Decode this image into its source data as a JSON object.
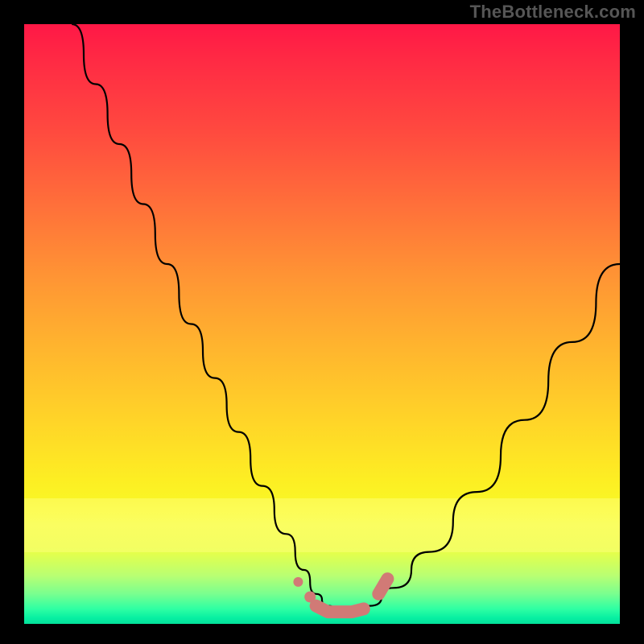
{
  "watermark": "TheBottleneck.com",
  "chart_data": {
    "type": "line",
    "title": "",
    "xlabel": "",
    "ylabel": "",
    "xlim": [
      0,
      100
    ],
    "ylim": [
      0,
      100
    ],
    "grid": false,
    "legend": false,
    "series": [
      {
        "name": "bottleneck-curve",
        "color": "#000000",
        "x": [
          8,
          12,
          16,
          20,
          24,
          28,
          32,
          36,
          40,
          44,
          47,
          49,
          51,
          53,
          56,
          58,
          62,
          68,
          76,
          84,
          92,
          100
        ],
        "values": [
          100,
          90,
          80,
          70,
          60,
          50,
          41,
          32,
          23,
          15,
          9,
          5,
          3,
          2,
          2,
          3,
          6,
          12,
          22,
          34,
          47,
          60
        ]
      }
    ],
    "markers": [
      {
        "name": "flat-range-dots",
        "color": "#d17a76",
        "points": [
          {
            "x": 46,
            "y": 7
          },
          {
            "x": 48,
            "y": 4.5
          },
          {
            "x": 49,
            "y": 3
          },
          {
            "x": 51,
            "y": 2
          },
          {
            "x": 53,
            "y": 2
          },
          {
            "x": 55,
            "y": 2
          },
          {
            "x": 57,
            "y": 2.5
          },
          {
            "x": 59.5,
            "y": 5
          },
          {
            "x": 61,
            "y": 7.5
          }
        ]
      }
    ],
    "background": {
      "type": "vertical-gradient",
      "stops": [
        {
          "pos": 0,
          "color": "#ff1846"
        },
        {
          "pos": 50,
          "color": "#ffb52e"
        },
        {
          "pos": 80,
          "color": "#fdee23"
        },
        {
          "pos": 100,
          "color": "#04e09a"
        }
      ]
    }
  }
}
